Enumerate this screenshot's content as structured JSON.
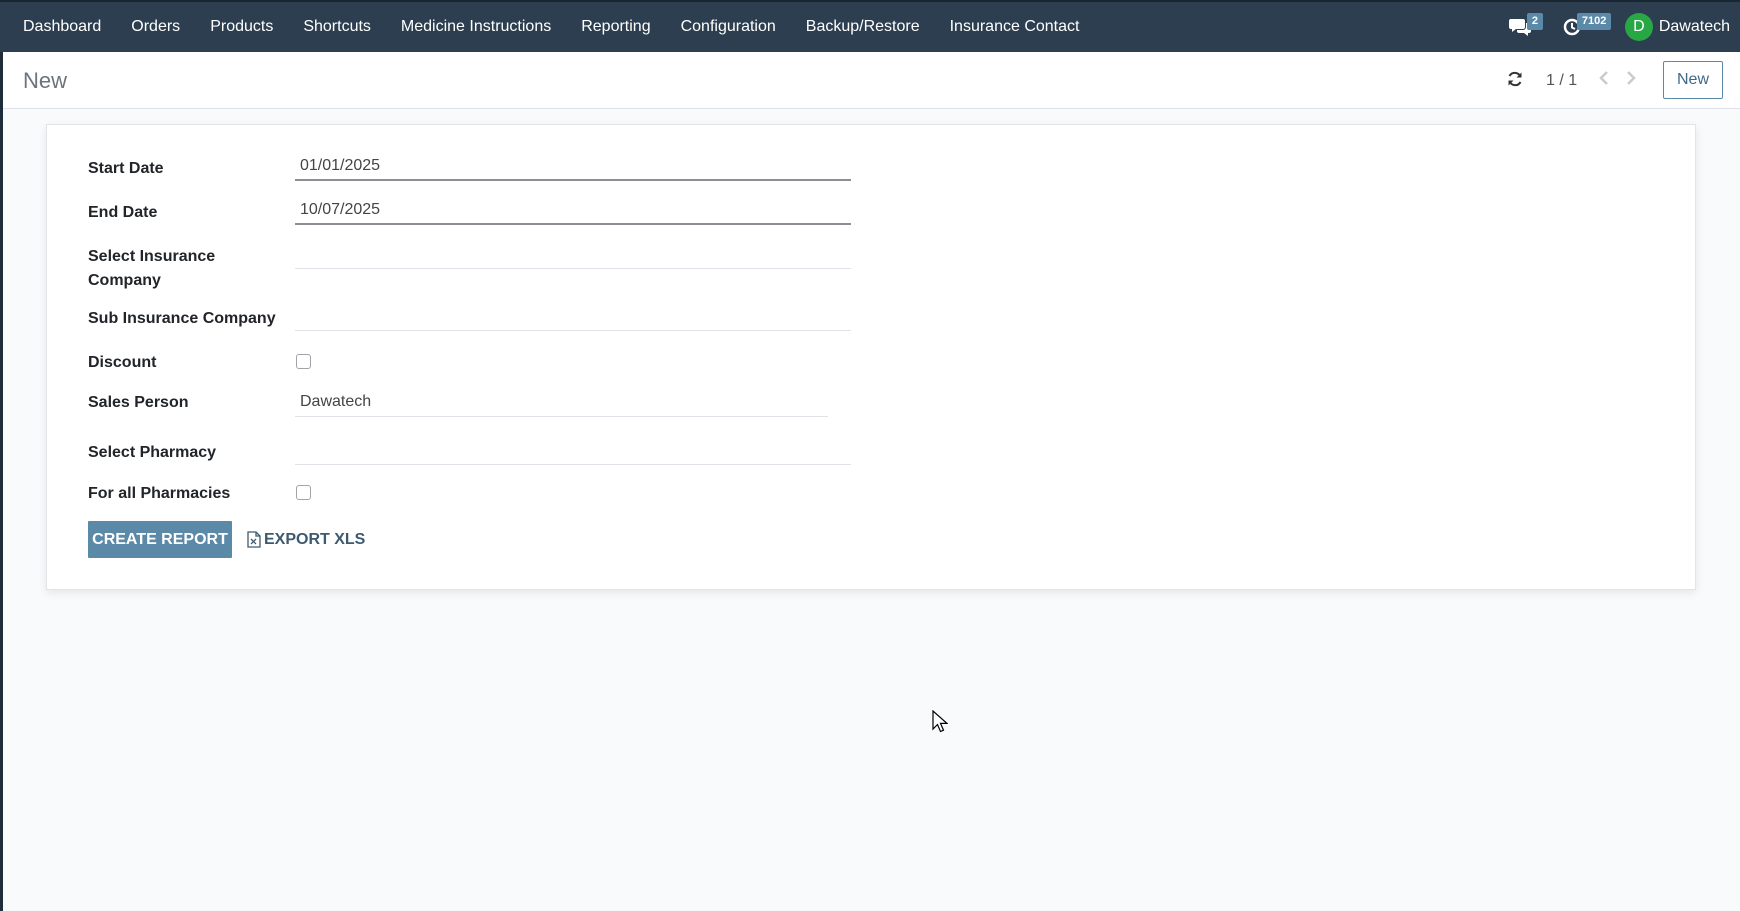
{
  "nav": {
    "items": [
      {
        "id": "dashboard",
        "label": "Dashboard"
      },
      {
        "id": "orders",
        "label": "Orders"
      },
      {
        "id": "products",
        "label": "Products"
      },
      {
        "id": "shortcuts",
        "label": "Shortcuts"
      },
      {
        "id": "medicine-instructions",
        "label": "Medicine Instructions"
      },
      {
        "id": "reporting",
        "label": "Reporting"
      },
      {
        "id": "configuration",
        "label": "Configuration"
      },
      {
        "id": "backup-restore",
        "label": "Backup/Restore"
      },
      {
        "id": "insurance-contact",
        "label": "Insurance Contact"
      }
    ],
    "messages_count": "2",
    "activities_count": "7102",
    "user_initial": "D",
    "user_name": "Dawatech"
  },
  "control_panel": {
    "breadcrumb": "New",
    "pager": "1 / 1",
    "new_button": "New"
  },
  "form": {
    "start_date": {
      "label": "Start Date",
      "value": "01/01/2025"
    },
    "end_date": {
      "label": "End Date",
      "value": "10/07/2025"
    },
    "insurance_company": {
      "label_line1": "Select Insurance",
      "label_line2": "Company",
      "value": ""
    },
    "sub_insurance_company": {
      "label": "Sub Insurance Company",
      "value": ""
    },
    "discount": {
      "label": "Discount",
      "checked": false
    },
    "sales_person": {
      "label": "Sales Person",
      "value": "Dawatech"
    },
    "pharmacy": {
      "label": "Select Pharmacy",
      "value": ""
    },
    "all_pharmacies": {
      "label": "For all Pharmacies",
      "checked": false
    },
    "create_report": "CREATE REPORT",
    "export_xls": "EXPORT XLS"
  },
  "colors": {
    "topbar": "#2c3e4f",
    "primary": "#5a8aa8",
    "avatar": "#28a745"
  },
  "icons": [
    "messages-icon",
    "clock-icon",
    "refresh-icon",
    "chevron-left-icon",
    "chevron-right-icon",
    "excel-file-icon",
    "mouse-cursor-icon"
  ]
}
